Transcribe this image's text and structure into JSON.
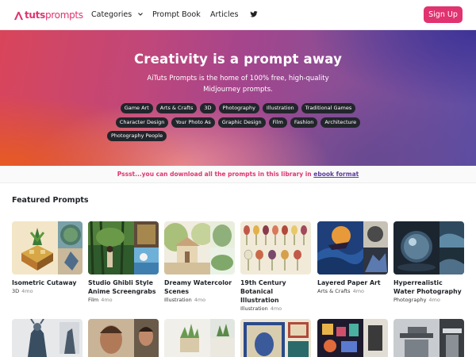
{
  "nav": {
    "logo_ai": "Ai",
    "logo_tuts": "tuts",
    "logo_prompts": "prompts",
    "categories": "Categories",
    "prompt_book": "Prompt Book",
    "articles": "Articles",
    "signup": "Sign Up",
    "twitter_icon": "twitter-icon"
  },
  "hero": {
    "title": "Creativity is a prompt away",
    "subtitle": "AiTuts Prompts is the home of 100% free, high-quality Midjourney prompts.",
    "chips_row1": [
      "Game Art",
      "Arts & Crafts",
      "3D",
      "Photography",
      "Illustration",
      "Traditional Games"
    ],
    "chips_row2": [
      "Character Design",
      "Your Photo As",
      "Graphic Design",
      "Film",
      "Fashion",
      "Architecture"
    ],
    "chips_row3": [
      "Photography People"
    ]
  },
  "notice": {
    "text": "Pssst...you can download all the prompts in this library in",
    "link": "ebook format"
  },
  "featured": {
    "heading": "Featured Prompts",
    "cards": [
      {
        "title": "Isometric Cutaway",
        "category": "3D",
        "age": "4mo"
      },
      {
        "title": "Studio Ghibli Style Anime Screengrabs",
        "category": "Film",
        "age": "4mo"
      },
      {
        "title": "Dreamy Watercolor Scenes",
        "category": "Illustration",
        "age": "4mo"
      },
      {
        "title": "19th Century Botanical Illustration",
        "category": "Illustration",
        "age": "4mo"
      },
      {
        "title": "Layered Paper Art",
        "category": "Arts & Crafts",
        "age": "4mo"
      },
      {
        "title": "Hyperrealistic Water Photography",
        "category": "Photography",
        "age": "4mo"
      }
    ]
  },
  "colors": {
    "brand": "#e0336f",
    "chip_bg": "#22252b",
    "link": "#5b3c9a"
  }
}
